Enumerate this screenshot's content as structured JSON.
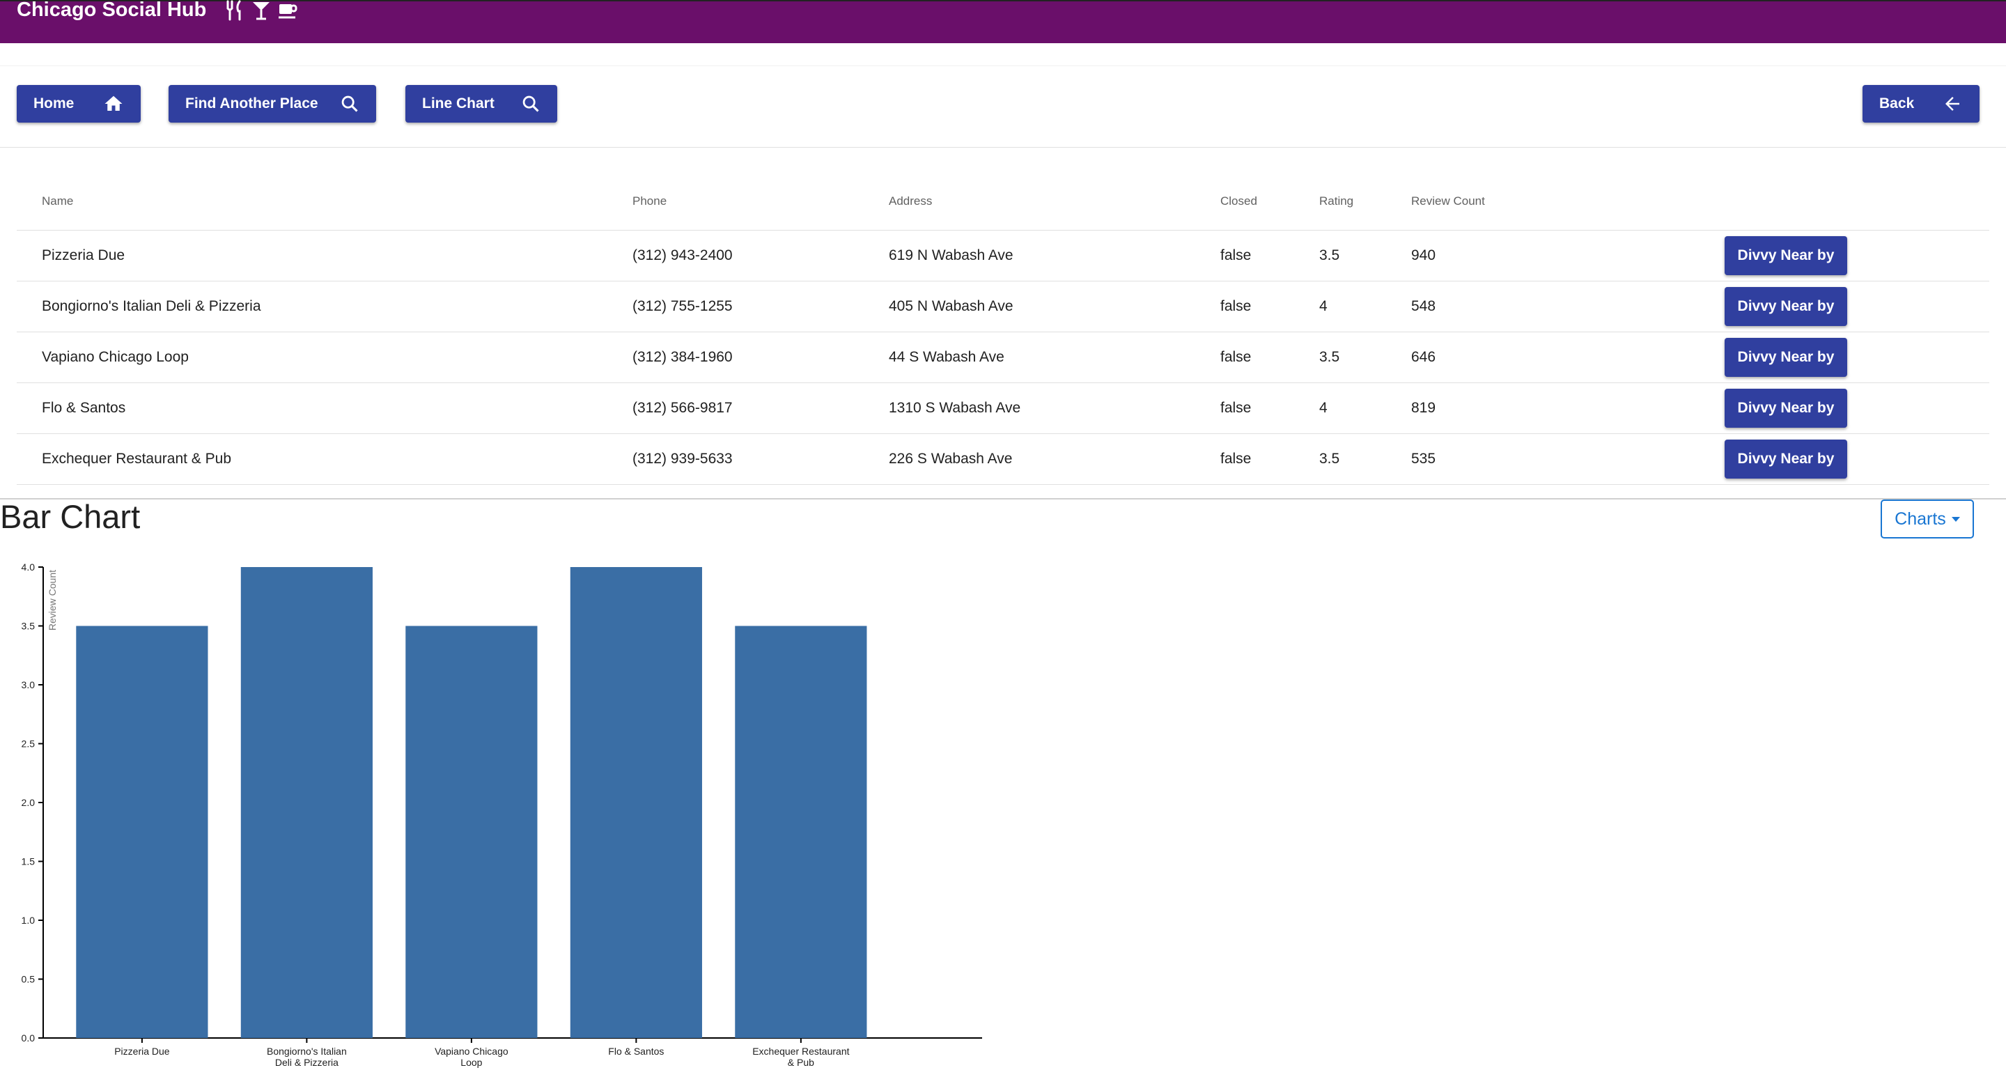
{
  "header": {
    "title": "Chicago Social Hub",
    "icons": [
      "restaurant-icon",
      "cocktail-icon",
      "coffee-cup-icon"
    ],
    "background_color": "#6a0f6a"
  },
  "toolbar": {
    "home_label": "Home",
    "find_label": "Find Another Place",
    "line_chart_label": "Line Chart",
    "back_label": "Back",
    "button_color": "#303f9f"
  },
  "table": {
    "columns": [
      "Name",
      "Phone",
      "Address",
      "Closed",
      "Rating",
      "Review Count"
    ],
    "action_label": "Divvy Near by",
    "rows": [
      {
        "name": "Pizzeria Due",
        "phone": "(312) 943-2400",
        "address": "619 N Wabash Ave",
        "closed": "false",
        "rating": "3.5",
        "review_count": "940"
      },
      {
        "name": "Bongiorno's Italian Deli & Pizzeria",
        "phone": "(312) 755-1255",
        "address": "405 N Wabash Ave",
        "closed": "false",
        "rating": "4",
        "review_count": "548"
      },
      {
        "name": "Vapiano Chicago Loop",
        "phone": "(312) 384-1960",
        "address": "44 S Wabash Ave",
        "closed": "false",
        "rating": "3.5",
        "review_count": "646"
      },
      {
        "name": "Flo & Santos",
        "phone": "(312) 566-9817",
        "address": "1310 S Wabash Ave",
        "closed": "false",
        "rating": "4",
        "review_count": "819"
      },
      {
        "name": "Exchequer Restaurant & Pub",
        "phone": "(312) 939-5633",
        "address": "226 S Wabash Ave",
        "closed": "false",
        "rating": "3.5",
        "review_count": "535"
      }
    ]
  },
  "chart_section": {
    "heading": "Bar Chart",
    "charts_button": "Charts"
  },
  "chart_data": {
    "type": "bar",
    "categories": [
      "Pizzeria Due",
      "Bongiorno's Italian Deli & Pizzeria",
      "Vapiano Chicago Loop",
      "Flo & Santos",
      "Exchequer Restaurant & Pub"
    ],
    "category_label_lines": [
      [
        "Pizzeria Due"
      ],
      [
        "Bongiorno's Italian",
        "Deli & Pizzeria"
      ],
      [
        "Vapiano Chicago",
        "Loop"
      ],
      [
        "Flo & Santos"
      ],
      [
        "Exchequer Restaurant",
        "& Pub"
      ]
    ],
    "values": [
      3.5,
      4,
      3.5,
      4,
      3.5
    ],
    "ylabel": "Review Count",
    "xlabel": "",
    "ylim": [
      0,
      4
    ],
    "y_ticks": [
      "0.0",
      "0.5",
      "1.0",
      "1.5",
      "2.0",
      "2.5",
      "3.0",
      "3.5",
      "4.0"
    ],
    "bar_color": "#3a6ea5",
    "grid": false
  }
}
